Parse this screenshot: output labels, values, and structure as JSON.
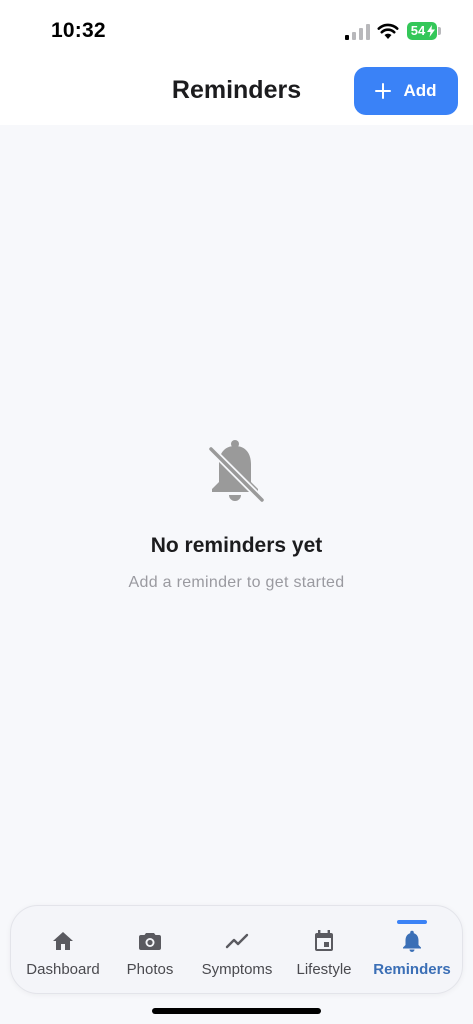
{
  "status_bar": {
    "time": "10:32",
    "battery": "54",
    "icons": [
      "signal-icon",
      "wifi-icon",
      "battery-icon"
    ]
  },
  "header": {
    "title": "Reminders",
    "add_label": "Add",
    "add_icon": "plus-icon",
    "accent_color": "#3a82f7"
  },
  "empty_state": {
    "icon": "bell-off-icon",
    "title": "No reminders yet",
    "subtitle": "Add a reminder to get started"
  },
  "tabs": [
    {
      "label": "Dashboard",
      "icon": "home-icon",
      "active": false
    },
    {
      "label": "Photos",
      "icon": "camera-icon",
      "active": false
    },
    {
      "label": "Symptoms",
      "icon": "trend-icon",
      "active": false
    },
    {
      "label": "Lifestyle",
      "icon": "calendar-icon",
      "active": false
    },
    {
      "label": "Reminders",
      "icon": "bell-icon",
      "active": true
    }
  ],
  "colors": {
    "active_tab": "#3b6fb6",
    "inactive_tab": "#4a4a4f",
    "background": "#f7f8fb"
  }
}
